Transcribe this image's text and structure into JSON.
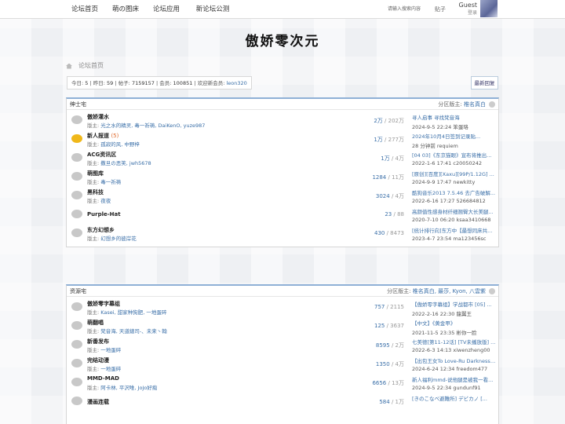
{
  "nav": {
    "items": [
      "论坛首页",
      "萌の图床",
      "论坛应用",
      "新论坛公测"
    ]
  },
  "header": {
    "search_placeholder": "请输入搜索内容",
    "tie": "贴子",
    "guest": "Guest",
    "login": "登录"
  },
  "banner": {
    "logo": "傲娇零次元"
  },
  "breadcrumb": {
    "home": "论坛首页"
  },
  "stats": {
    "today_label": "今日:",
    "today": "5",
    "yesterday_label": "昨日:",
    "yesterday": "59",
    "posts_label": "帖子:",
    "posts": "7159157",
    "members_label": "会员:",
    "members": "100851",
    "newest_label": "欢迎新会员:",
    "newest": "leon320"
  },
  "latest_button": "最新回复",
  "groups": [
    {
      "title": "绅士宅",
      "mods_label": "分区版主:",
      "mods": "椎名真白",
      "forums": [
        {
          "name": "傲娇灌水",
          "badge": "",
          "mods_label": "版主:",
          "mods": "光之水的精灵, 毒一祈祷, DaiKenO, yuze987",
          "threads": "2万",
          "posts": "202万",
          "last_title": "寻人启事 寻找梵音海",
          "last_meta": "2024-9-5 22:24 笨蛋珞",
          "new": false
        },
        {
          "name": "新人报道",
          "badge": "(5)",
          "mods_label": "版主:",
          "mods": "孤寂的风, 中野梓",
          "threads": "1万",
          "posts": "277万",
          "last_title": "2024年10月4日签到记录贴...",
          "last_meta": "28 分钟前 requiem",
          "new": true
        },
        {
          "name": "ACG资讯区",
          "badge": "",
          "mods_label": "版主:",
          "mods": "撒旦の恶笑, jwh5678",
          "threads": "1万",
          "posts": "4万",
          "last_title": "[04 03]《东京猫眼》宣布将推出...",
          "last_meta": "2022-1-6 17:41 c20050242",
          "new": false
        },
        {
          "name": "萌图库",
          "badge": "",
          "mods_label": "版主:",
          "mods": "毒一祈祷",
          "threads": "1284",
          "posts": "11万",
          "last_title": "[原创][百度][Xaxu][99P/1.12G] ...",
          "last_meta": "2024-9-9 17:47 newkitty",
          "new": false
        },
        {
          "name": "黑科技",
          "badge": "",
          "mods_label": "版主:",
          "mods": "夜夜",
          "threads": "3024",
          "posts": "4万",
          "last_title": "酷狗音乐2013 7.5.46 去广告破解...",
          "last_meta": "2022-6-16 17:27 526684812",
          "new": false
        },
        {
          "name": "Purple-Hat",
          "badge": "",
          "mods_label": "",
          "mods": "",
          "threads": "23",
          "posts": "88",
          "last_title": "高颜值性感身材纤细翘臀大长美腿...",
          "last_meta": "2020-7-10 06:20 ksaa3410668",
          "new": false
        },
        {
          "name": "东方幻想乡",
          "badge": "",
          "mods_label": "版主:",
          "mods": "幻想乡的彼岸花",
          "threads": "430",
          "posts": "8473",
          "last_title": "[统计排行向]东方中【最想同床共...",
          "last_meta": "2023-4-7 23:54 ma123456sc",
          "new": false
        }
      ]
    },
    {
      "title": "资源宅",
      "mods_label": "分区版主:",
      "mods": "椎名真白, 最莎, Kyon, 八雲紫",
      "forums": [
        {
          "name": "傲娇零字幕组",
          "badge": "",
          "mods_label": "版主:",
          "mods": "Kasei, 甜家种狗肥, 一地蛋碎",
          "threads": "757",
          "posts": "2115",
          "last_title": "【傲娇零字幕组】学战都市 [05] ...",
          "last_meta": "2022-2-16 22:30 龍翼王",
          "new": false
        },
        {
          "name": "萌翻唱",
          "badge": "",
          "mods_label": "版主:",
          "mods": "梵音海, 天道總司-、未来丶翰",
          "threads": "125",
          "posts": "3637",
          "last_title": "【中文】《黄金甲》",
          "last_meta": "2021-11-5 23:35 彬你一脸",
          "new": false
        },
        {
          "name": "新番发布",
          "badge": "",
          "mods_label": "版主:",
          "mods": "一地蛋碎",
          "threads": "8595",
          "posts": "2万",
          "last_title": "七美德[第11-12话] [TV未播放版] ...",
          "last_meta": "2022-6-3 14:13 xiwenzheng00",
          "new": false
        },
        {
          "name": "完结动漫",
          "badge": "",
          "mods_label": "版主:",
          "mods": "一地蛋碎",
          "threads": "1350",
          "posts": "4万",
          "last_title": "【出包王女To Love-Ru Darkness ...",
          "last_meta": "2024-6-24 12:34 freedom477",
          "new": false
        },
        {
          "name": "MMD-MAD",
          "badge": "",
          "mods_label": "版主:",
          "mods": "阿卡林, 平沢唯, JoJo好痴",
          "threads": "6656",
          "posts": "13万",
          "last_title": "新人福利mmd-说他腿是被我一看...",
          "last_meta": "2024-9-5 22:34 gundunf91",
          "new": false
        },
        {
          "name": "漫画连载",
          "badge": "",
          "mods_label": "",
          "mods": "",
          "threads": "584",
          "posts": "1万",
          "last_title": "[きのこなべ避難所] デビカノ [...",
          "last_meta": "",
          "new": false
        }
      ]
    }
  ]
}
